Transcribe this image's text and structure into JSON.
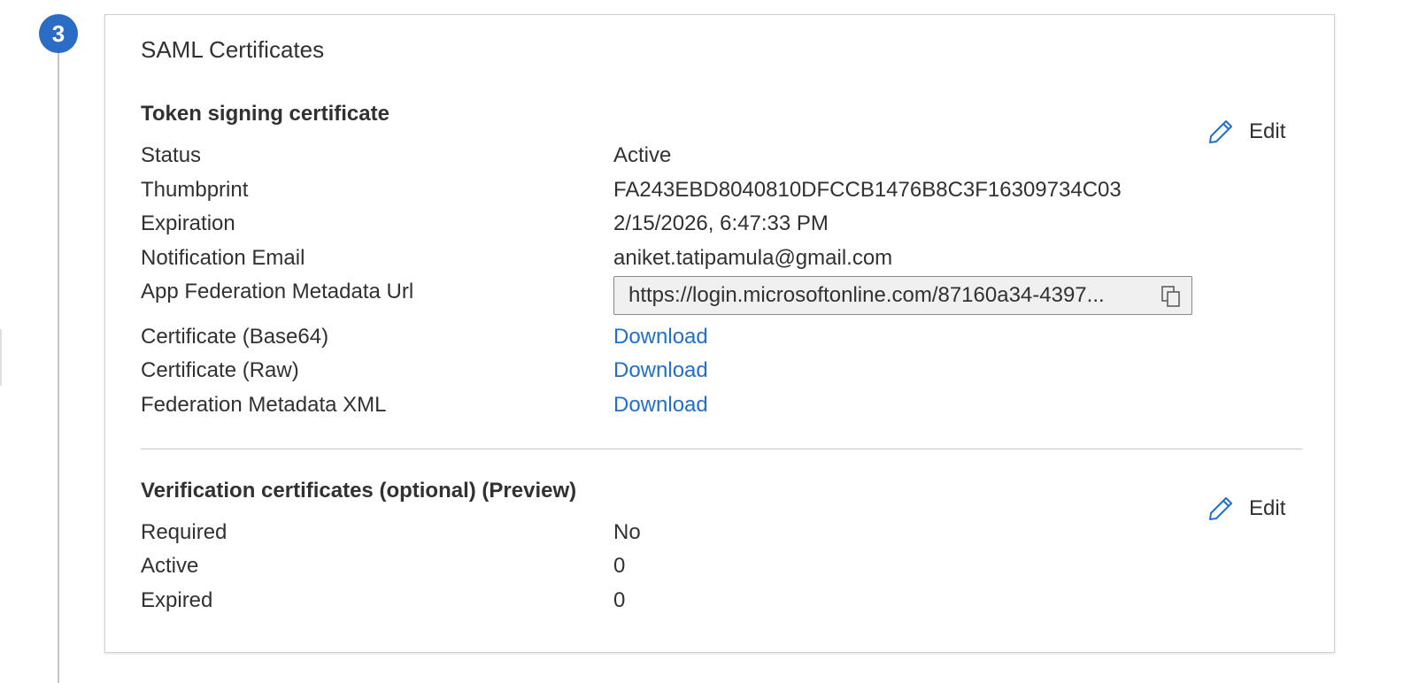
{
  "step": {
    "number": "3"
  },
  "card": {
    "title": "SAML Certificates",
    "token_signing": {
      "heading": "Token signing certificate",
      "edit_label": "Edit",
      "rows": [
        {
          "label": "Status",
          "value": "Active"
        },
        {
          "label": "Thumbprint",
          "value": "FA243EBD8040810DFCCB1476B8C3F16309734C03"
        },
        {
          "label": "Expiration",
          "value": "2/15/2026, 6:47:33 PM"
        },
        {
          "label": "Notification Email",
          "value": "aniket.tatipamula@gmail.com"
        }
      ],
      "metadata_url": {
        "label": "App Federation Metadata Url",
        "value": "https://login.microsoftonline.com/87160a34-4397..."
      },
      "downloads": [
        {
          "label": "Certificate (Base64)",
          "link": "Download"
        },
        {
          "label": "Certificate (Raw)",
          "link": "Download"
        },
        {
          "label": "Federation Metadata XML",
          "link": "Download"
        }
      ]
    },
    "verification": {
      "heading": "Verification certificates (optional) (Preview)",
      "edit_label": "Edit",
      "rows": [
        {
          "label": "Required",
          "value": "No"
        },
        {
          "label": "Active",
          "value": "0"
        },
        {
          "label": "Expired",
          "value": "0"
        }
      ]
    }
  },
  "colors": {
    "accent": "#2b6cc4",
    "link": "#1f6fcf",
    "text": "#323130",
    "border": "#d2d0ce"
  },
  "icons": {
    "edit": "pencil-icon",
    "copy": "copy-icon"
  }
}
